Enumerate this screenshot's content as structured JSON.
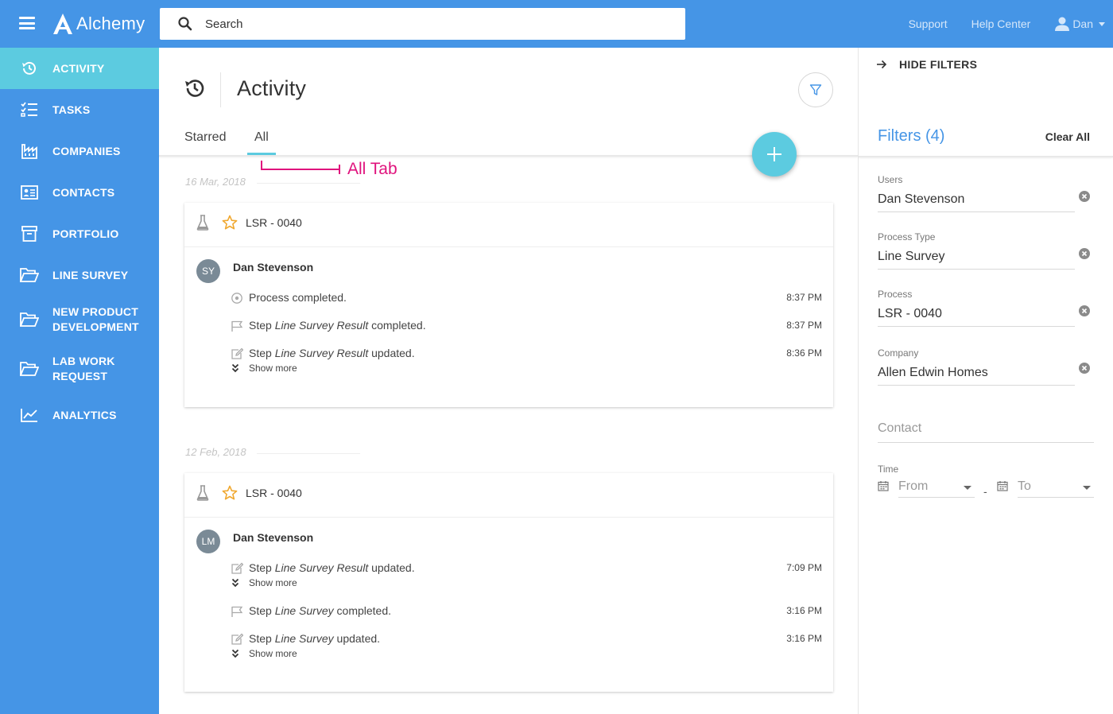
{
  "app": {
    "name": "Alchemy"
  },
  "search": {
    "placeholder": "Search"
  },
  "topnav": {
    "support": "Support",
    "help": "Help Center",
    "user": "Dan"
  },
  "sidebar": {
    "items": [
      {
        "label": "ACTIVITY",
        "icon": "history-icon",
        "active": true
      },
      {
        "label": "TASKS",
        "icon": "checklist-icon"
      },
      {
        "label": "COMPANIES",
        "icon": "factory-icon"
      },
      {
        "label": "CONTACTS",
        "icon": "contact-card-icon"
      },
      {
        "label": "PORTFOLIO",
        "icon": "archive-box-icon"
      },
      {
        "label": "LINE SURVEY",
        "icon": "folder-open-icon"
      },
      {
        "label": "NEW PRODUCT DEVELOPMENT",
        "line1": "NEW PRODUCT",
        "line2": "DEVELOPMENT",
        "icon": "folder-open-icon"
      },
      {
        "label": "LAB WORK REQUEST",
        "line1": "LAB WORK",
        "line2": "REQUEST",
        "icon": "folder-open-icon"
      },
      {
        "label": "ANALYTICS",
        "icon": "line-chart-icon"
      }
    ]
  },
  "main": {
    "title": "Activity",
    "tabs": [
      {
        "label": "Starred"
      },
      {
        "label": "All",
        "active": true
      }
    ],
    "annotation": "All Tab",
    "groups": [
      {
        "date": "16 Mar, 2018",
        "card": {
          "title": "LSR - 0040",
          "avatar": "SY",
          "author": "Dan Stevenson",
          "events": [
            {
              "icon": "circle-dot-icon",
              "pre": "Process completed.",
              "em": "",
              "post": "",
              "time": "8:37 PM"
            },
            {
              "icon": "flag-icon",
              "pre": "Step ",
              "em": "Line Survey Result",
              "post": " completed.",
              "time": "8:37 PM"
            },
            {
              "icon": "edit-icon",
              "pre": "Step ",
              "em": "Line Survey Result",
              "post": " updated.",
              "time": "8:36 PM",
              "show_more": "Show more"
            }
          ]
        }
      },
      {
        "date": "12 Feb, 2018",
        "card": {
          "title": "LSR - 0040",
          "avatar": "LM",
          "author": "Dan Stevenson",
          "events": [
            {
              "icon": "edit-icon",
              "pre": "Step ",
              "em": "Line Survey Result",
              "post": " updated.",
              "time": "7:09 PM",
              "show_more": "Show more"
            },
            {
              "icon": "flag-icon",
              "pre": "Step ",
              "em": "Line Survey",
              "post": " completed.",
              "time": "3:16 PM"
            },
            {
              "icon": "edit-icon",
              "pre": "Step ",
              "em": "Line Survey",
              "post": " updated.",
              "time": "3:16 PM",
              "show_more": "Show more"
            }
          ]
        }
      }
    ]
  },
  "filters": {
    "hide_label": "HIDE FILTERS",
    "title": "Filters (4)",
    "clear_all": "Clear All",
    "fields": [
      {
        "label": "Users",
        "value": "Dan Stevenson"
      },
      {
        "label": "Process Type",
        "value": "Line Survey"
      },
      {
        "label": "Process",
        "value": "LSR - 0040"
      },
      {
        "label": "Company",
        "value": "Allen Edwin Homes"
      }
    ],
    "contact_placeholder": "Contact",
    "time_label": "Time",
    "from": "From",
    "to": "To",
    "separator": "-"
  },
  "colors": {
    "primary": "#4595e6",
    "accent": "#5ccbe0",
    "annotation": "#e0137d",
    "star": "#f0a830"
  }
}
